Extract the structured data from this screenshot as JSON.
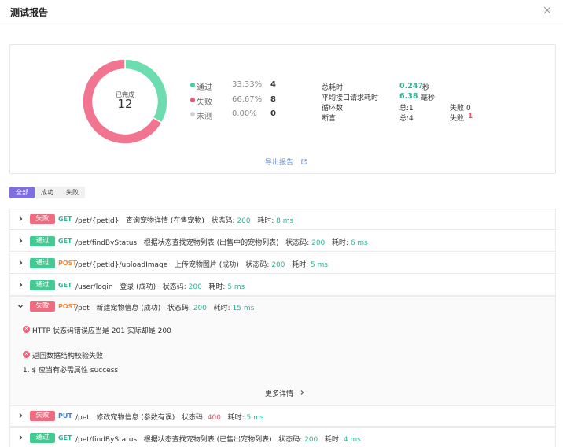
{
  "dialog": {
    "title": "测试报告"
  },
  "summary": {
    "donut": {
      "center_label": "已完成",
      "center_count": "12",
      "pass_fraction": 0.3333,
      "fail_fraction": 0.6667,
      "colors": {
        "pass": "#6ddcb0",
        "fail": "#f17491"
      }
    },
    "legend": [
      {
        "label": "通过",
        "percent": "33.33%",
        "count": "4",
        "color": "#3ecf9a"
      },
      {
        "label": "失败",
        "percent": "66.67%",
        "count": "8",
        "color": "#ec5473"
      },
      {
        "label": "未测",
        "percent": "0.00%",
        "count": "0",
        "color": "#d0d0d0"
      }
    ],
    "stats": {
      "total_time_label": "总耗时",
      "total_time_value": "0.247",
      "total_time_unit": "秒",
      "avg_label": "平均接口请求耗时",
      "avg_value": "6.38",
      "avg_unit": "毫秒",
      "loops_label": "循环数",
      "loops_total": "总:1",
      "loops_fail": "失败:0",
      "assert_label": "断言",
      "assert_total": "总:4",
      "assert_fail_prefix": "失败:",
      "assert_fail_value": "1"
    },
    "export_label": "导出报告"
  },
  "filters": [
    "全部",
    "成功",
    "失败"
  ],
  "rows": [
    {
      "status": "失败",
      "kind": "fail",
      "method": "GET",
      "path": "/pet/{petId}",
      "desc": "查询宠物详情 (在售宠物)",
      "code_label": "状态码:",
      "code": "200",
      "time_label": "耗时:",
      "time": "8 ms"
    },
    {
      "status": "通过",
      "kind": "pass",
      "method": "GET",
      "path": "/pet/findByStatus",
      "desc": "根据状态查找宠物列表 (出售中的宠物列表)",
      "code_label": "状态码:",
      "code": "200",
      "time_label": "耗时:",
      "time": "6 ms"
    },
    {
      "status": "通过",
      "kind": "pass",
      "method": "POST",
      "path": "/pet/{petId}/uploadImage",
      "desc": "上传宠物图片 (成功)",
      "code_label": "状态码:",
      "code": "200",
      "time_label": "耗时:",
      "time": "5 ms"
    },
    {
      "status": "通过",
      "kind": "pass",
      "method": "GET",
      "path": "/user/login",
      "desc": "登录 (成功)",
      "code_label": "状态码:",
      "code": "200",
      "time_label": "耗时:",
      "time": "5 ms"
    },
    {
      "status": "失败",
      "kind": "fail",
      "method": "POST",
      "path": "/pet",
      "desc": "新建宠物信息 (成功)",
      "code_label": "状态码:",
      "code": "200",
      "time_label": "耗时:",
      "time": "15 ms"
    },
    {
      "status": "失败",
      "kind": "fail",
      "method": "PUT",
      "path": "/pet",
      "desc": "修改宠物信息 (参数有误)",
      "code_label": "状态码:",
      "code": "400",
      "time_label": "耗时:",
      "time": "5 ms"
    },
    {
      "status": "通过",
      "kind": "pass",
      "method": "GET",
      "path": "/pet/findByStatus",
      "desc": "根据状态查找宠物列表 (已售出宠物列表)",
      "code_label": "状态码:",
      "code": "200",
      "time_label": "耗时:",
      "time": "4 ms"
    }
  ],
  "detail": {
    "error1": "HTTP 状态码错误应当是 201 实际却是 200",
    "error2": "返回数据结构校验失败",
    "item1": "1. $ 应当有必需属性 success",
    "more": "更多详情"
  },
  "method_colors": {
    "GET": "#2eb398",
    "POST": "#f0883a",
    "PUT": "#3a7fd8"
  }
}
